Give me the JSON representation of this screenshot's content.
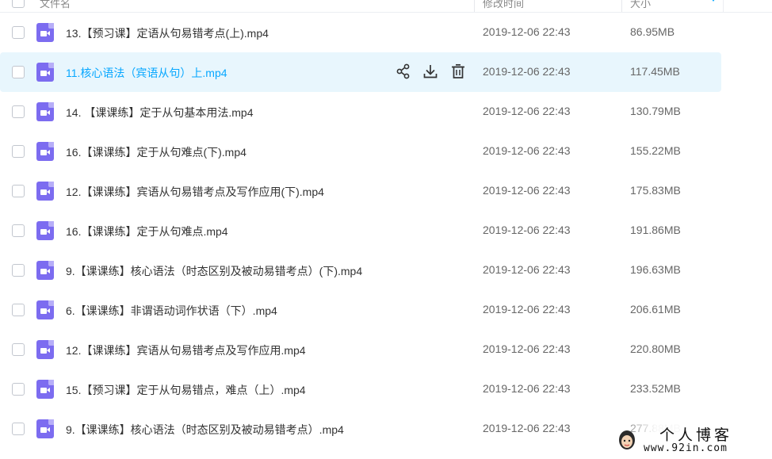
{
  "header": {
    "col_name": "文件名",
    "col_modified": "修改时间",
    "col_size": "大小"
  },
  "actions": {
    "share": "share-icon",
    "download": "download-icon",
    "delete": "trash-icon"
  },
  "files": [
    {
      "name": "13.【预习课】定语从句易错考点(上).mp4",
      "modified": "2019-12-06 22:43",
      "size": "86.95MB"
    },
    {
      "name": "11.核心语法（宾语从句）上.mp4",
      "modified": "2019-12-06 22:43",
      "size": "117.45MB"
    },
    {
      "name": "14. 【课课练】定于从句基本用法.mp4",
      "modified": "2019-12-06 22:43",
      "size": "130.79MB"
    },
    {
      "name": "16.【课课练】定于从句难点(下).mp4",
      "modified": "2019-12-06 22:43",
      "size": "155.22MB"
    },
    {
      "name": "12.【课课练】宾语从句易错考点及写作应用(下).mp4",
      "modified": "2019-12-06 22:43",
      "size": "175.83MB"
    },
    {
      "name": "16.【课课练】定于从句难点.mp4",
      "modified": "2019-12-06 22:43",
      "size": "191.86MB"
    },
    {
      "name": "9.【课课练】核心语法（时态区别及被动易错考点）(下).mp4",
      "modified": "2019-12-06 22:43",
      "size": "196.63MB"
    },
    {
      "name": "6.【课课练】非谓语动词作状语（下）.mp4",
      "modified": "2019-12-06 22:43",
      "size": "206.61MB"
    },
    {
      "name": "12.【课课练】宾语从句易错考点及写作应用.mp4",
      "modified": "2019-12-06 22:43",
      "size": "220.80MB"
    },
    {
      "name": "15.【预习课】定于从句易错点，难点（上）.mp4",
      "modified": "2019-12-06 22:43",
      "size": "233.52MB"
    },
    {
      "name": "9.【课课练】核心语法（时态区别及被动易错考点）.mp4",
      "modified": "2019-12-06 22:43",
      "size": "277.88MB"
    }
  ],
  "watermark": {
    "title": "个人博客",
    "url": "www.92in.com"
  },
  "colors": {
    "accent": "#06a7ff",
    "row_hover": "#e8f6fd",
    "video_icon": "#7c6cf0"
  }
}
